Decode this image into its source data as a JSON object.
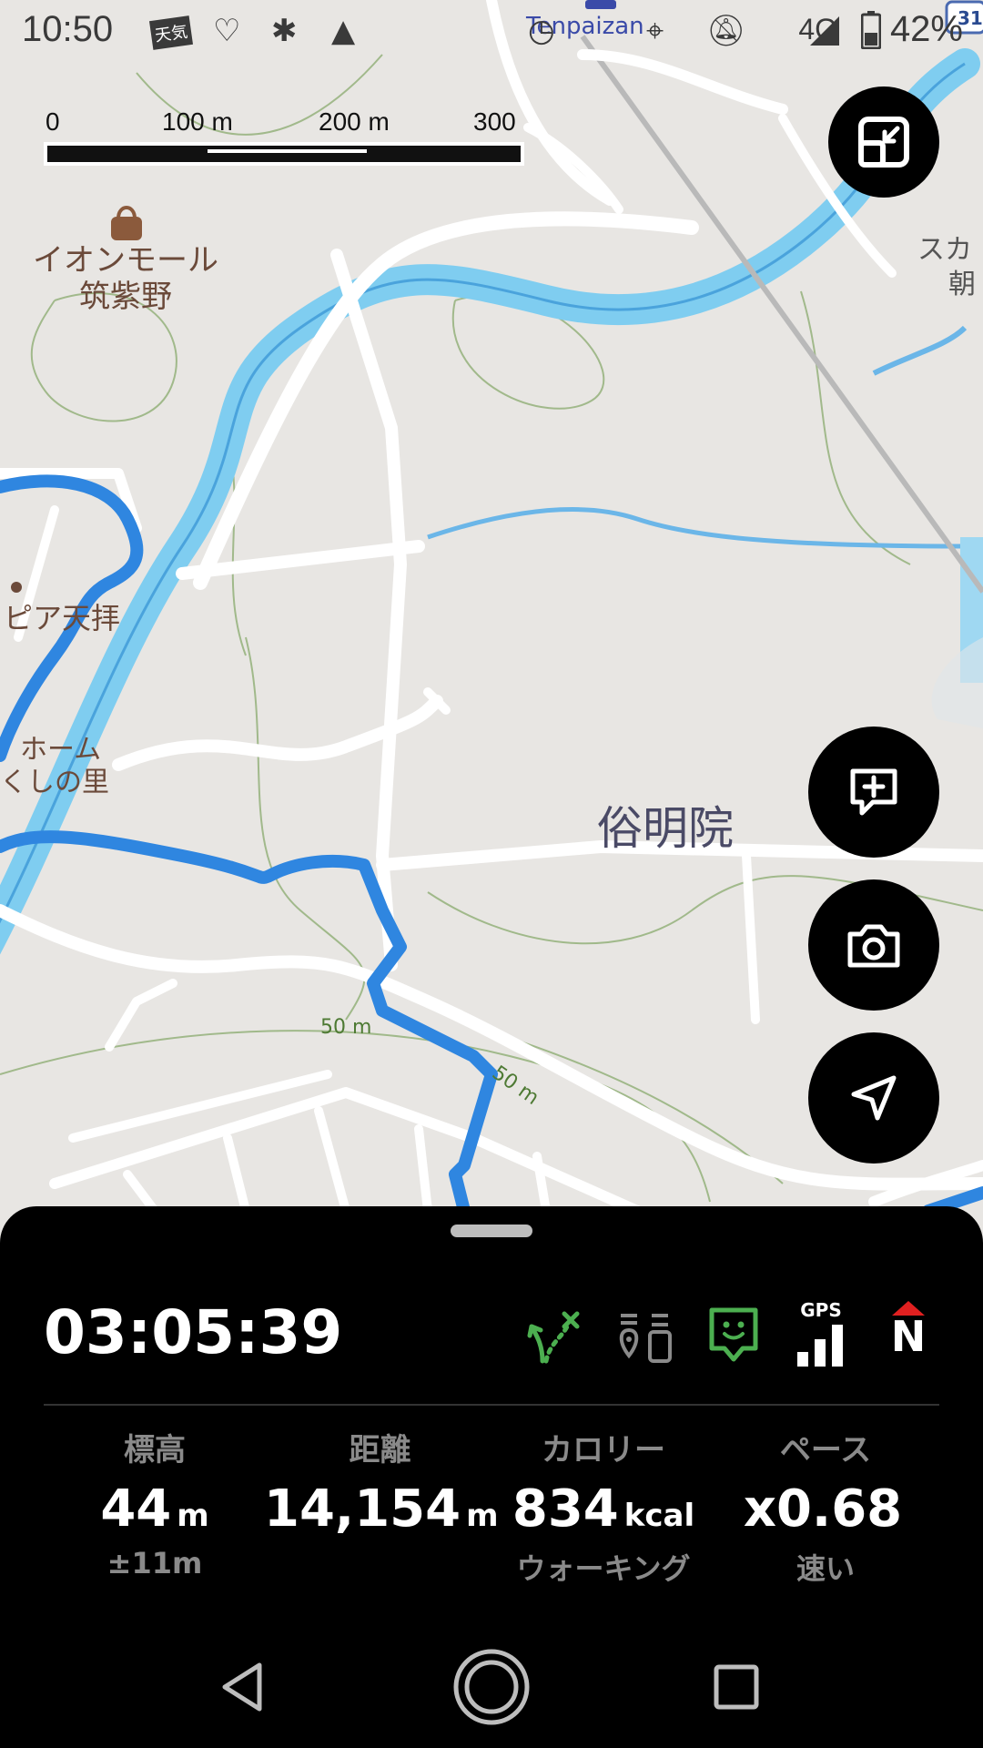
{
  "status_bar": {
    "time": "10:50",
    "battery_text": "42%",
    "network": "4G",
    "weather_badge": "天気",
    "icons": [
      "weather-icon",
      "health-icon",
      "fan-icon",
      "triangle-icon",
      "alarm-icon",
      "location-icon",
      "mute-icon",
      "signal-icon",
      "battery-icon"
    ]
  },
  "map": {
    "scale_labels": [
      "0",
      "100 m",
      "200 m",
      "300 m"
    ],
    "place_labels": {
      "aeon_line1": "イオンモール",
      "aeon_line2": "筑紫野",
      "tenpaizan": "Tenpaizan",
      "pia": "ピア天拝",
      "home_line1": "ホーム",
      "home_line2": "くしの里",
      "zokumei": "俗明院",
      "suka_line1": "スカ",
      "suka_line2": "朝",
      "contour1": "50 m",
      "contour2": "50 m",
      "route_num": "31"
    },
    "colors": {
      "route": "#2f86e0",
      "river": "#7fcdf0",
      "road": "#ffffff",
      "land": "#e8e6e3",
      "contour": "#8fae74"
    }
  },
  "buttons": {
    "exit_fullscreen": "exit-fullscreen-icon",
    "add_note": "add-note-icon",
    "camera": "camera-icon",
    "navigate": "navigation-arrow-icon"
  },
  "panel": {
    "elapsed": "03:05:39",
    "gps_label": "GPS",
    "north_label": "N",
    "stats": [
      {
        "label": "標高",
        "value": "44",
        "unit": "m",
        "sub": "±11m"
      },
      {
        "label": "距離",
        "value": "14,154",
        "unit": "m",
        "sub": ""
      },
      {
        "label": "カロリー",
        "value": "834",
        "unit": "kcal",
        "sub": "ウォーキング"
      },
      {
        "label": "ペース",
        "value": "x0.68",
        "unit": "",
        "sub": "速い"
      }
    ],
    "accent": "#4caf50"
  }
}
